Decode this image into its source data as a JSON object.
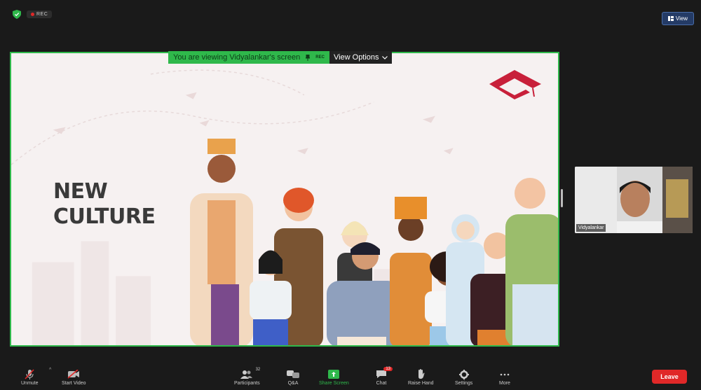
{
  "status": {
    "rec_label": "REC"
  },
  "view_button": {
    "label": "View"
  },
  "share_banner": {
    "message": "You are viewing Vidyalankar's screen",
    "rec_label": "REC",
    "view_options_label": "View Options"
  },
  "slide": {
    "title_line1": "NEW",
    "title_line2": "CULTURE"
  },
  "participant": {
    "name": "Vidyalankar"
  },
  "toolbar": {
    "unmute_label": "Unmute",
    "start_video_label": "Start Video",
    "participants_label": "Participants",
    "participants_count": "32",
    "qa_label": "Q&A",
    "share_screen_label": "Share Screen",
    "chat_label": "Chat",
    "chat_badge": "13",
    "raise_hand_label": "Raise Hand",
    "settings_label": "Settings",
    "more_label": "More",
    "leave_label": "Leave"
  },
  "colors": {
    "accent_green": "#2fb84b",
    "leave_red": "#e02828",
    "logo_red": "#c8203a"
  }
}
